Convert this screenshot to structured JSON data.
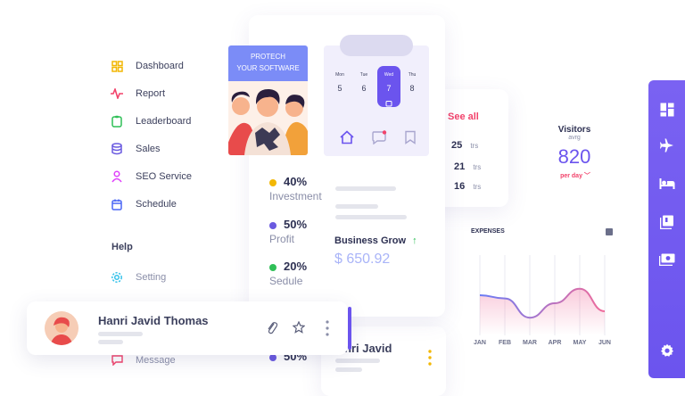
{
  "menu": {
    "items": [
      {
        "label": "Dashboard",
        "icon": "dashboard-icon",
        "color": "#f2b705"
      },
      {
        "label": "Report",
        "icon": "pulse-icon",
        "color": "#f2436b"
      },
      {
        "label": "Leaderboard",
        "icon": "clipboard-icon",
        "color": "#2fbf57"
      },
      {
        "label": "Sales",
        "icon": "database-icon",
        "color": "#6a5ae0"
      },
      {
        "label": "SEO Service",
        "icon": "user-icon",
        "color": "#e040fb"
      },
      {
        "label": "Schedule",
        "icon": "calendar-icon",
        "color": "#4a67f5"
      }
    ],
    "help_heading": "Help",
    "help_items": [
      {
        "label": "Setting",
        "icon": "gear-icon",
        "color": "#36c2ea"
      },
      {
        "label": "Message",
        "icon": "chat-icon",
        "color": "#f2436b"
      }
    ]
  },
  "banner": {
    "line1": "PROTECH",
    "line2": "YOUR SOFTWARE"
  },
  "calendar": {
    "days": [
      "Mon",
      "Tue",
      "Wed",
      "Thu"
    ],
    "dates": [
      "5",
      "6",
      "7",
      "8"
    ]
  },
  "stats": [
    {
      "value": "40%",
      "label": "Investment",
      "color": "#f2b705"
    },
    {
      "value": "50%",
      "label": "Profit",
      "color": "#6a5ae0"
    },
    {
      "value": "20%",
      "label": "Sedule",
      "color": "#2fbf57"
    }
  ],
  "business": {
    "label": "Business Grow",
    "value": "$ 650.92"
  },
  "see_all": {
    "label": "See all",
    "rows": [
      {
        "value": "25",
        "unit": "trs"
      },
      {
        "value": "21",
        "unit": "trs"
      },
      {
        "value": "16",
        "unit": "trs"
      }
    ]
  },
  "visitors": {
    "title": "Visitors",
    "sub": "avrg",
    "value": "820",
    "period": "per day"
  },
  "expenses": {
    "title": "EXPENSES"
  },
  "chart_data": {
    "type": "line",
    "title": "EXPENSES",
    "categories": [
      "JAN",
      "FEB",
      "MAR",
      "APR",
      "MAY",
      "JUN"
    ],
    "values": [
      50,
      46,
      22,
      40,
      58,
      30
    ],
    "ylim": [
      0,
      100
    ],
    "grid": true,
    "colors": [
      "#6a7cf5",
      "#f06b9a"
    ]
  },
  "contact": {
    "name": "Hanri Javid Thomas",
    "name_partial": "nri Javid"
  },
  "lower_stat": {
    "value": "50%"
  },
  "colors": {
    "accent": "#6b54ee",
    "pink": "#f2436b",
    "banner": "#7b8cf7"
  }
}
